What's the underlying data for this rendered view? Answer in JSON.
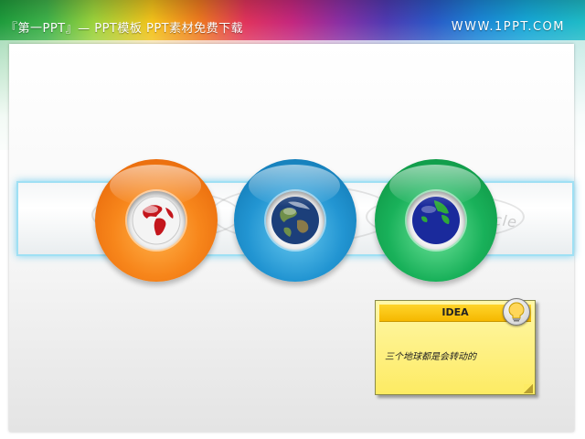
{
  "header": {
    "title": "『第一PPT』— PPT模板 PPT素材免费下载",
    "site": "WWW.1PPT.COM"
  },
  "strip": {
    "watermark": "cle"
  },
  "rings": [
    {
      "name": "orange",
      "color": "#f7861b",
      "icon": "globe-red-icon"
    },
    {
      "name": "blue",
      "color": "#2295d2",
      "icon": "globe-earth-icon"
    },
    {
      "name": "green",
      "color": "#19b15a",
      "icon": "globe-blue-icon"
    }
  ],
  "note": {
    "heading": "IDEA",
    "body": "三个地球都是会转动的",
    "icon": "lightbulb-icon",
    "color": "#fdeb63"
  }
}
